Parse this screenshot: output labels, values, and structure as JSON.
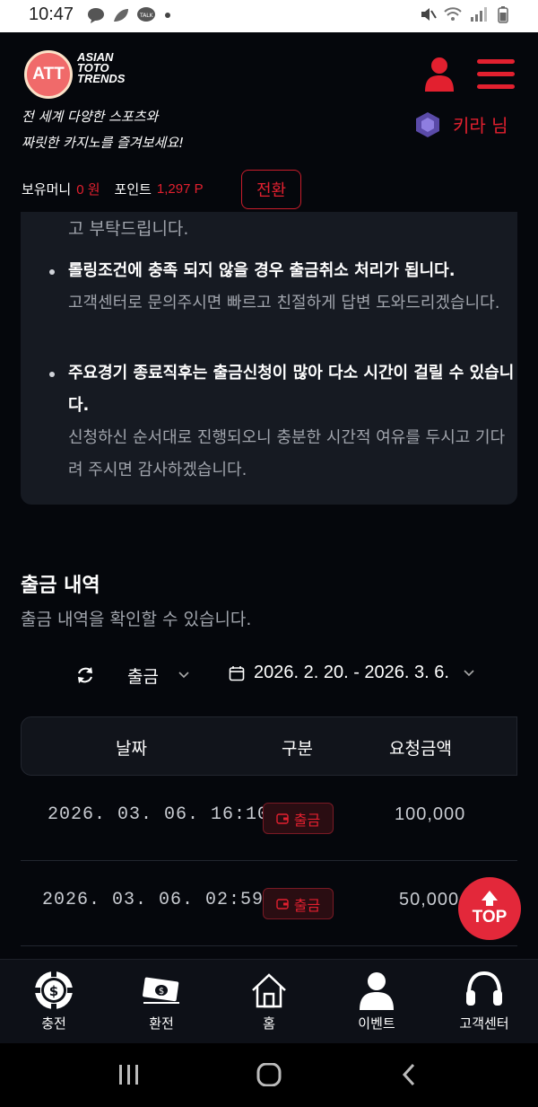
{
  "status_bar": {
    "time": "10:47"
  },
  "header": {
    "logo_mark": "ATT",
    "logo_lines": [
      "ASIAN",
      "TOTO",
      "TRENDS"
    ],
    "tagline_1": "전 세계 다양한 스포츠와",
    "tagline_2": "짜릿한 카지노를 즐겨보세요!",
    "username": "키라 님",
    "money_label": "보유머니",
    "money_value": "0 원",
    "point_label": "포인트",
    "point_value": "1,297 P",
    "convert_label": "전환"
  },
  "notice": {
    "top_line": "고 부탁드립니다.",
    "items": [
      {
        "strong": "롤링조건에 충족 되지 않을 경우 출금취소 처리가 됩니다.",
        "sub": "고객센터로 문의주시면 빠르고 친절하게 답변 도와드리겠습니다."
      },
      {
        "strong": "주요경기 종료직후는 출금신청이 많아 다소 시간이 걸릴 수 있습니다.",
        "sub": "신청하신 순서대로 진행되오니 충분한 시간적 여유를 두시고 기다려 주시면 감사하겠습니다."
      }
    ]
  },
  "history": {
    "title": "출금 내역",
    "subtitle": "출금 내역을 확인할 수 있습니다.",
    "type_filter": "출금",
    "date_range": "2026. 2. 20. - 2026. 3. 6.",
    "columns": [
      "날짜",
      "구분",
      "요청금액"
    ],
    "rows": [
      {
        "date": "2026. 03. 06. 16:10",
        "type": "출금",
        "amount": "100,000"
      },
      {
        "date": "2026. 03. 06. 02:59",
        "type": "출금",
        "amount": "50,000"
      }
    ]
  },
  "top_button": "TOP",
  "bottom_nav": [
    {
      "label": "충전",
      "icon": "chip-icon"
    },
    {
      "label": "환전",
      "icon": "money-icon"
    },
    {
      "label": "홈",
      "icon": "home-icon"
    },
    {
      "label": "이벤트",
      "icon": "person-icon"
    },
    {
      "label": "고객센터",
      "icon": "headset-icon"
    }
  ],
  "colors": {
    "accent": "#e2202f",
    "background": "#05070c",
    "card": "#161a22"
  }
}
